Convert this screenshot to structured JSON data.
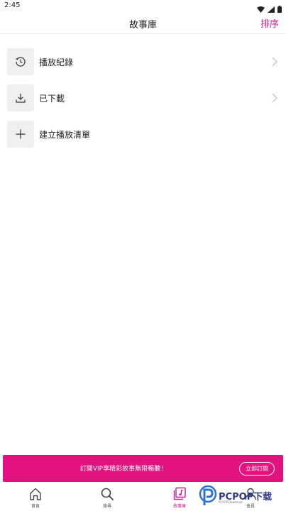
{
  "status_bar": {
    "time": "2:45"
  },
  "header": {
    "title": "故事庫",
    "sort_label": "排序"
  },
  "menu": {
    "items": [
      {
        "label": "播放紀錄",
        "icon": "history-icon",
        "has_chevron": true
      },
      {
        "label": "已下載",
        "icon": "download-icon",
        "has_chevron": true
      },
      {
        "label": "建立播放清單",
        "icon": "plus-icon",
        "has_chevron": false
      }
    ]
  },
  "vip_banner": {
    "text": "訂閱VIP享精彩故事無限暢聽！",
    "button_label": "立即訂閱"
  },
  "bottom_nav": {
    "items": [
      {
        "label": "首頁",
        "icon": "home-icon"
      },
      {
        "label": "搜尋",
        "icon": "search-icon"
      },
      {
        "label": "故事庫",
        "icon": "music-library-icon",
        "active": true
      },
      {
        "label": "會員",
        "icon": "user-icon"
      }
    ]
  },
  "watermark": {
    "brand": "PCPOP下载",
    "tagline": "PCPOP.Download"
  },
  "colors": {
    "accent": "#d6168b",
    "banner": "#e2127e",
    "icon_bg": "#efefef"
  }
}
